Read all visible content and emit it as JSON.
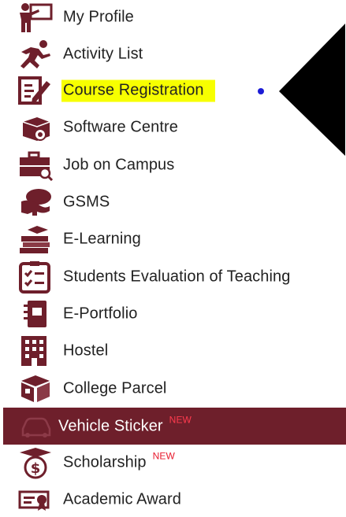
{
  "menu": {
    "items": [
      {
        "label": "My Profile",
        "icon": "teacher-board-icon"
      },
      {
        "label": "Activity List",
        "icon": "running-person-icon"
      },
      {
        "label": "Course Registration",
        "icon": "form-pencil-icon"
      },
      {
        "label": "Software Centre",
        "icon": "software-box-icon"
      },
      {
        "label": "Job on Campus",
        "icon": "briefcase-search-icon"
      },
      {
        "label": "GSMS",
        "icon": "hand-coin-icon"
      },
      {
        "label": "E-Learning",
        "icon": "books-graduation-icon"
      },
      {
        "label": "Students Evaluation of Teaching",
        "icon": "checklist-icon"
      },
      {
        "label": "E-Portfolio",
        "icon": "notebook-icon"
      },
      {
        "label": "Hostel",
        "icon": "building-icon"
      },
      {
        "label": "College Parcel",
        "icon": "parcel-box-icon"
      },
      {
        "label": "Vehicle Sticker",
        "icon": "car-icon",
        "badge": "NEW"
      },
      {
        "label": "Scholarship",
        "icon": "scholarship-dollar-icon",
        "badge": "NEW"
      },
      {
        "label": "Academic Award",
        "icon": "certificate-icon"
      }
    ]
  },
  "colors": {
    "icon": "#6e1f2b",
    "active_background": "#6e1f2b",
    "highlight": "#f7ff00",
    "dot": "#1c1cd6",
    "badge": "#e8192c"
  }
}
